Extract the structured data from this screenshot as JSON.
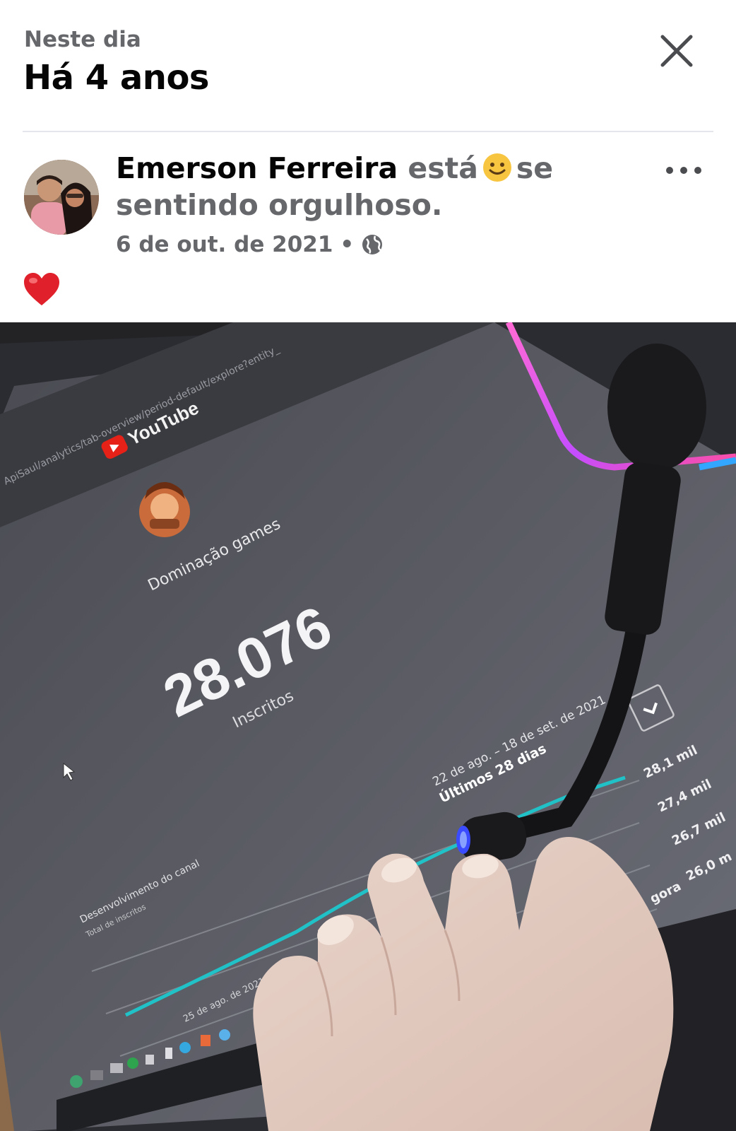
{
  "header": {
    "subtitle": "Neste dia",
    "title": "Há 4 anos"
  },
  "post": {
    "author": "Emerson Ferreira",
    "activity_before": "está",
    "activity_after": "se sentindo orgulhoso.",
    "date": "6 de out. de 2021",
    "separator": "•",
    "privacy_icon": "globe-icon",
    "caption_icon": "heart-icon"
  },
  "photo": {
    "url_fragment": "ApiSaul/analytics/tab-overview/period-default/explore?entity_",
    "brand": "YouTube",
    "channel_name": "Dominação games",
    "subscriber_count": "28.076",
    "subscriber_label": "Inscritos",
    "date_range": "22 de ago. – 18 de set. de 2021",
    "period_label": "Últimos 28 dias",
    "y_ticks": [
      "28,1 mil",
      "27,4 mil",
      "26,7 mil",
      "26,0 m"
    ],
    "x_tick": "25 de ago. de 2021",
    "x_end_label": "gora",
    "chart_title": "Desenvolvimento do canal",
    "chart_subtitle": "Total de inscritos"
  },
  "colors": {
    "text_primary": "#050505",
    "text_secondary": "#65676b",
    "divider": "#e4e6eb",
    "line_series": "#20c2c8",
    "youtube_red": "#e62117"
  }
}
